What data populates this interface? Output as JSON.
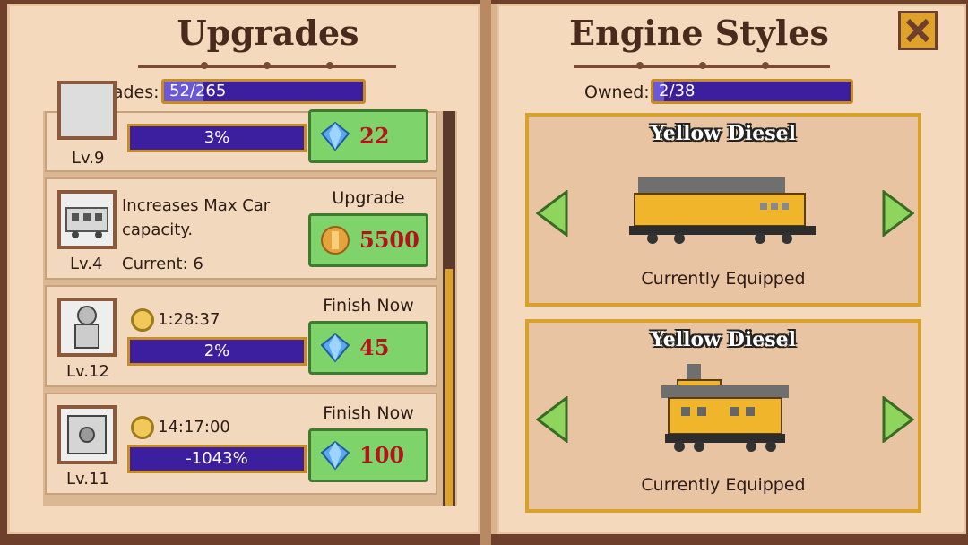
{
  "upgrades": {
    "title": "Upgrades",
    "counter_label": "Upgrades:",
    "counter_value": "52/265",
    "counter_fraction": 0.196,
    "items": [
      {
        "level": "Lv.9",
        "progress_text": "3%",
        "cost": "22",
        "cost_type": "gem-icon"
      },
      {
        "level": "Lv.4",
        "description": "Increases Max Car capacity.",
        "current": "Current: 6",
        "button_label": "Upgrade",
        "cost": "5500",
        "cost_type": "coin-icon"
      },
      {
        "level": "Lv.12",
        "timer": "1:28:37",
        "progress_text": "2%",
        "button_label": "Finish Now",
        "cost": "45",
        "cost_type": "gem-icon"
      },
      {
        "level": "Lv.11",
        "timer": "14:17:00",
        "progress_text": "-1043%",
        "button_label": "Finish Now",
        "cost": "100",
        "cost_type": "gem-icon"
      }
    ]
  },
  "engine_styles": {
    "title": "Engine Styles",
    "owned_label": "Owned:",
    "owned_value": "2/38",
    "owned_fraction": 0.053,
    "cards": [
      {
        "name": "Yellow Diesel",
        "status": "Currently Equipped"
      },
      {
        "name": "Yellow Diesel",
        "status": "Currently Equipped"
      }
    ]
  },
  "colors": {
    "page": "#f4d9bd",
    "bar": "#3c1f9e",
    "bar_border": "#c78d1e",
    "button_green": "#7fd36b",
    "cost_red": "#b3131b",
    "card_border": "#d9a12b"
  }
}
